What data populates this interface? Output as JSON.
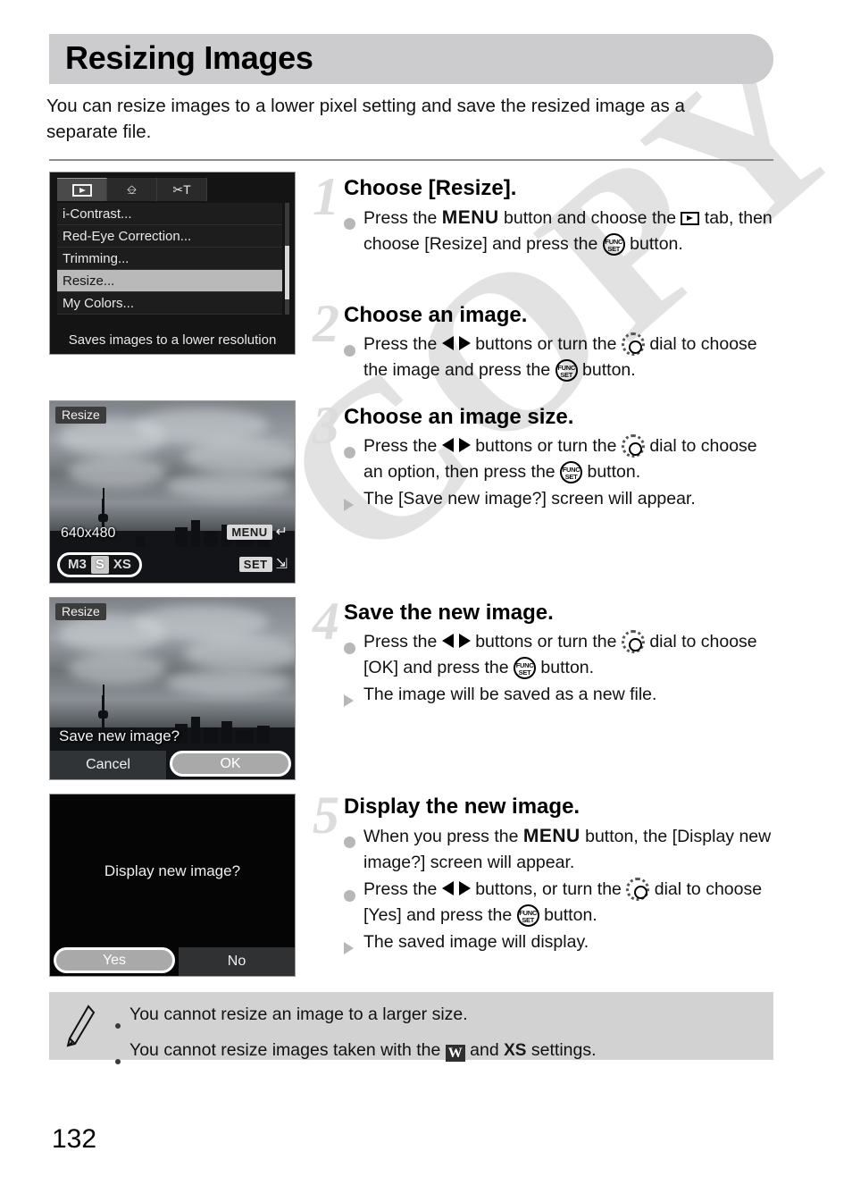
{
  "document": {
    "title": "Resizing Images",
    "intro": "You can resize images to a lower pixel setting and save the resized image as a separate file.",
    "page_number": "132",
    "watermark": "COPY"
  },
  "screens": {
    "menu": {
      "tabs": [
        "playback-tab",
        "print-tab",
        "settings-tab"
      ],
      "items": [
        "i-Contrast...",
        "Red-Eye Correction...",
        "Trimming...",
        "Resize...",
        "My Colors..."
      ],
      "selected_item": "Resize...",
      "footer": "Saves images to a lower resolution"
    },
    "resize_preview": {
      "label": "Resize",
      "dimensions": "640x480",
      "size_options": [
        "M3",
        "S",
        "XS"
      ],
      "selected_size": "S",
      "hint_menu_key": "MENU",
      "hint_set_key": "SET"
    },
    "save_confirm": {
      "label": "Resize",
      "question": "Save new image?",
      "buttons": [
        "Cancel",
        "OK"
      ],
      "selected_button": "OK"
    },
    "display_confirm": {
      "question": "Display new image?",
      "buttons": [
        "Yes",
        "No"
      ],
      "selected_button": "Yes"
    }
  },
  "steps": [
    {
      "number": "1",
      "title": "Choose [Resize].",
      "lines": [
        {
          "marker": "dot",
          "parts": [
            {
              "t": "text",
              "v": "Press the "
            },
            {
              "t": "menu",
              "v": "MENU"
            },
            {
              "t": "text",
              "v": " button and choose the "
            },
            {
              "t": "play",
              "v": ""
            },
            {
              "t": "text",
              "v": " tab, then choose [Resize] and press the "
            },
            {
              "t": "func",
              "v": "FUNC SET"
            },
            {
              "t": "text",
              "v": " button."
            }
          ]
        }
      ]
    },
    {
      "number": "2",
      "title": "Choose an image.",
      "lines": [
        {
          "marker": "dot",
          "parts": [
            {
              "t": "text",
              "v": "Press the "
            },
            {
              "t": "lr",
              "v": ""
            },
            {
              "t": "text",
              "v": " buttons or turn the "
            },
            {
              "t": "dial",
              "v": ""
            },
            {
              "t": "text",
              "v": " dial to choose the image and press the "
            },
            {
              "t": "func",
              "v": "FUNC SET"
            },
            {
              "t": "text",
              "v": " button."
            }
          ]
        }
      ]
    },
    {
      "number": "3",
      "title": "Choose an image size.",
      "lines": [
        {
          "marker": "dot",
          "parts": [
            {
              "t": "text",
              "v": "Press the "
            },
            {
              "t": "lr",
              "v": ""
            },
            {
              "t": "text",
              "v": " buttons or turn the "
            },
            {
              "t": "dial",
              "v": ""
            },
            {
              "t": "text",
              "v": " dial to choose an option, then press the "
            },
            {
              "t": "func",
              "v": "FUNC SET"
            },
            {
              "t": "text",
              "v": " button."
            }
          ]
        },
        {
          "marker": "triangle",
          "parts": [
            {
              "t": "text",
              "v": "The [Save new image?] screen will appear."
            }
          ]
        }
      ]
    },
    {
      "number": "4",
      "title": "Save the new image.",
      "lines": [
        {
          "marker": "dot",
          "parts": [
            {
              "t": "text",
              "v": "Press the "
            },
            {
              "t": "lr",
              "v": ""
            },
            {
              "t": "text",
              "v": " buttons or turn the "
            },
            {
              "t": "dial",
              "v": ""
            },
            {
              "t": "text",
              "v": " dial to choose [OK] and press the "
            },
            {
              "t": "func",
              "v": "FUNC SET"
            },
            {
              "t": "text",
              "v": " button."
            }
          ]
        },
        {
          "marker": "triangle",
          "parts": [
            {
              "t": "text",
              "v": "The image will be saved as a new file."
            }
          ]
        }
      ]
    },
    {
      "number": "5",
      "title": "Display the new image.",
      "lines": [
        {
          "marker": "dot",
          "parts": [
            {
              "t": "text",
              "v": "When you press the "
            },
            {
              "t": "menu",
              "v": "MENU"
            },
            {
              "t": "text",
              "v": " button, the [Display new image?] screen will appear."
            }
          ]
        },
        {
          "marker": "dot",
          "parts": [
            {
              "t": "text",
              "v": "Press the "
            },
            {
              "t": "lr",
              "v": ""
            },
            {
              "t": "text",
              "v": " buttons, or turn the "
            },
            {
              "t": "dial",
              "v": ""
            },
            {
              "t": "text",
              "v": " dial to choose [Yes] and press the "
            },
            {
              "t": "func",
              "v": "FUNC SET"
            },
            {
              "t": "text",
              "v": " button."
            }
          ]
        },
        {
          "marker": "triangle",
          "parts": [
            {
              "t": "text",
              "v": "The saved image will display."
            }
          ]
        }
      ]
    }
  ],
  "note": {
    "lines": [
      {
        "parts": [
          {
            "t": "text",
            "v": "You cannot resize an image to a larger size."
          }
        ]
      },
      {
        "parts": [
          {
            "t": "text",
            "v": "You cannot resize images taken with the "
          },
          {
            "t": "w",
            "v": "W"
          },
          {
            "t": "text",
            "v": " and "
          },
          {
            "t": "xs",
            "v": "XS"
          },
          {
            "t": "text",
            "v": " settings."
          }
        ]
      }
    ]
  },
  "colors": {
    "header_bar": "#ccccce",
    "note_bg": "#d2d2d2",
    "step_number": "#dcdcdc",
    "bullet": "#b7b7b7",
    "watermark": "#e2e2e2"
  }
}
